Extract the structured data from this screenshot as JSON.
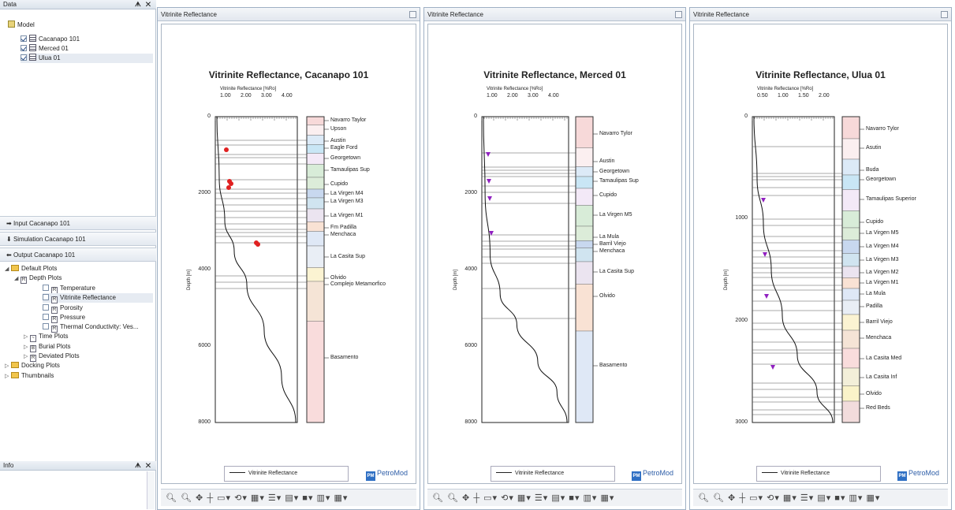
{
  "left": {
    "data_title": "Data",
    "pane_buttons": "ᗗ ✕",
    "model_label": "Model",
    "wells": [
      "Cacanapo 101",
      "Merced 01",
      "Ulua 01"
    ],
    "input_label": "Input Cacanapo 101",
    "simulation_label": "Simulation Cacanapo 101",
    "output_label": "Output Cacanapo 101",
    "tree": {
      "default_plots": "Default Plots",
      "depth_plots": "Depth Plots",
      "depth_items": [
        "Temperature",
        "Vitrinite Reflectance",
        "Porosity",
        "Pressure",
        "Thermal Conductivity: Ves..."
      ],
      "time_plots": "Time Plots",
      "burial_plots": "Burial Plots",
      "deviated_plots": "Deviated Plots",
      "docking_plots": "Docking Plots",
      "thumbnails": "Thumbnails"
    },
    "info_title": "Info"
  },
  "panels": [
    {
      "tab": "Vitrinite Reflectance",
      "title": "Vitrinite Reflectance, Cacanapo 101",
      "xlabel": "Vitrinite Reflectance [%Ro]",
      "xticks": [
        "1.00",
        "2.00",
        "3.00",
        "4.00"
      ],
      "ylabel": "Depth [m]",
      "yticks": [
        "0",
        "2000",
        "4000",
        "6000",
        "8000"
      ],
      "formations": [
        "Navarro Taylor",
        "Upson",
        "Austin",
        "Eagle Ford",
        "Georgetown",
        "Tamaulipas Sup",
        "Cupido",
        "La Virgen M4",
        "La Virgen M3",
        "La Virgen M1",
        "Fm Padilla",
        "Menchaca",
        "La Casita Sup",
        "Olvido",
        "Complejo Metamorfico",
        "Basamento"
      ],
      "legend": "Vitrinite Reflectance",
      "logo": "PetroMod"
    },
    {
      "tab": "Vitrinite Reflectance",
      "title": "Vitrinite Reflectance, Merced 01",
      "xlabel": "Vitrinite Reflectance [%Ro]",
      "xticks": [
        "1.00",
        "2.00",
        "3.00",
        "4.00"
      ],
      "ylabel": "Depth [m]",
      "yticks": [
        "0",
        "2000",
        "4000",
        "6000",
        "8000"
      ],
      "formations": [
        "Navarro Tylor",
        "Austin",
        "Georgetown",
        "Tamaulipas Sup",
        "Cupido",
        "La Virgen M5",
        "La Mula",
        "Barril Viejo",
        "Menchaca",
        "La Casita Sup",
        "Olvido",
        "Basamento"
      ],
      "legend": "Vitrinite Reflectance",
      "logo": "PetroMod"
    },
    {
      "tab": "Vitrinite Reflectance",
      "title": "Vitrinite Reflectance, Ulua 01",
      "xlabel": "Vitrinite Reflectance [%Ro]",
      "xticks": [
        "0.50",
        "1.00",
        "1.50",
        "2.00"
      ],
      "ylabel": "Depth [m]",
      "yticks": [
        "0",
        "1000",
        "2000",
        "3000"
      ],
      "formations": [
        "Navarro Tylor",
        "Asutin",
        "Buda",
        "Georgetown",
        "Tamaulipas Superior",
        "Cupido",
        "La Virgen M5",
        "La Virgen M4",
        "La Virgen M3",
        "La Virgen M2",
        "La Virgen M1",
        "La Mula",
        "Padilla",
        "Barril Viejo",
        "Menchaca",
        "La Casita Med",
        "La Casita Inf",
        "Olvido",
        "Red Beds"
      ],
      "legend": "Vitrinite Reflectance",
      "logo": "PetroMod"
    }
  ],
  "toolbar_glyphs": "🔍︎ 🔍︎ ✥ ┼ ▭▾ ⟲▾ ▦▾ ☰▾ ▤▾ ■▾ ▥▾ ▦▾"
}
